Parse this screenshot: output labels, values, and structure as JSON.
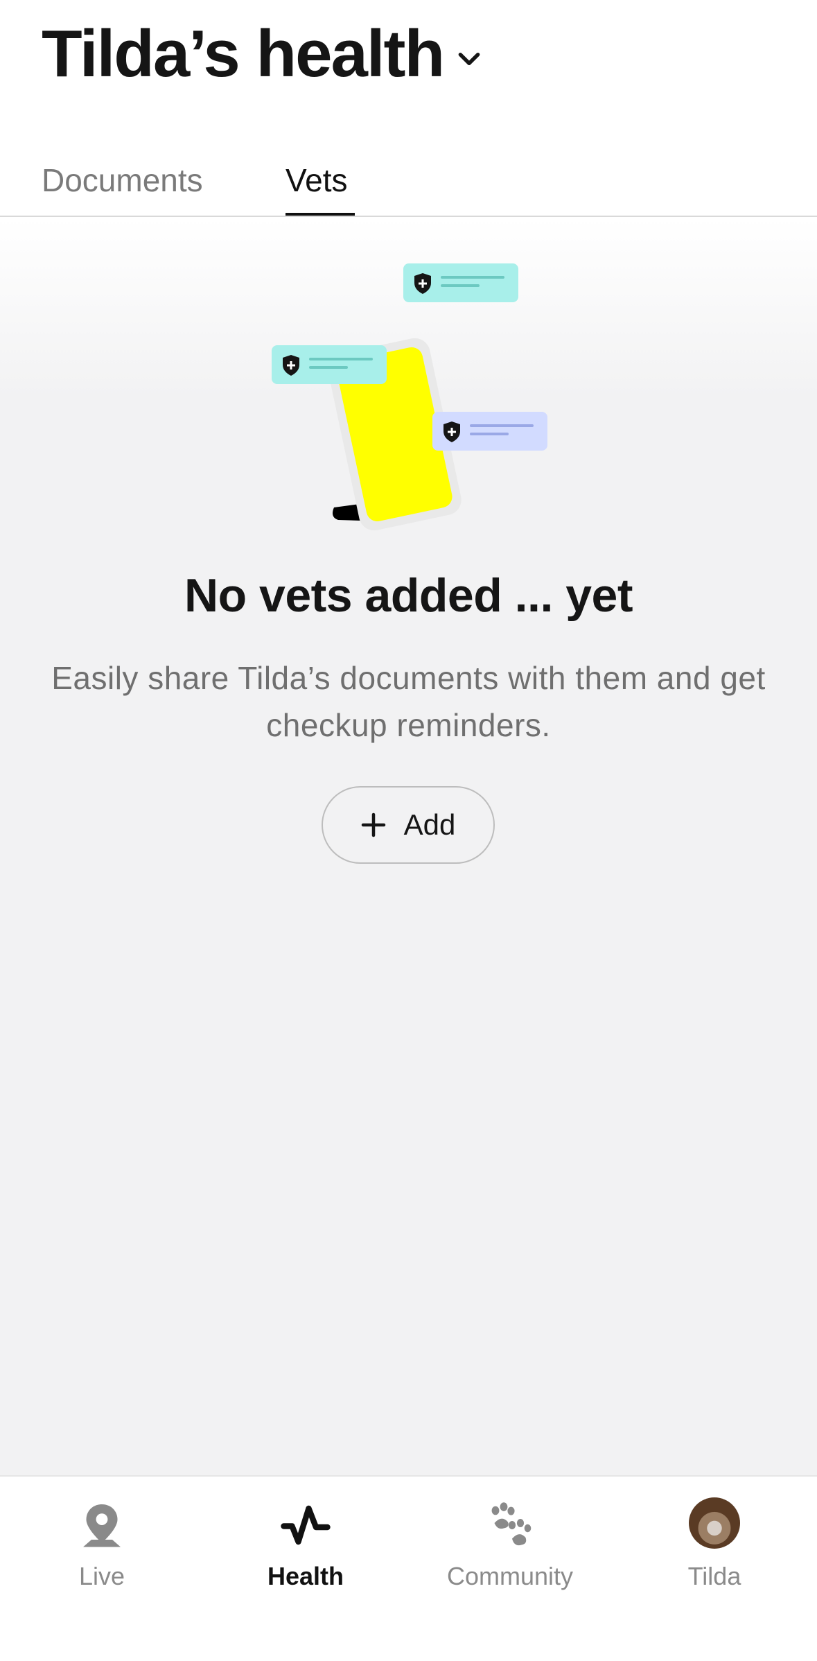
{
  "header": {
    "title": "Tilda’s health",
    "dropdown_icon": "chevron-down-icon"
  },
  "tabs": [
    {
      "label": "Documents",
      "active": false
    },
    {
      "label": "Vets",
      "active": true
    }
  ],
  "empty_state": {
    "title": "No vets added ... yet",
    "description": "Easily share Tilda’s documents with them and get checkup reminders.",
    "add_button_label": "Add",
    "add_icon": "plus-icon"
  },
  "illustration": {
    "phone_color": "#ffff00",
    "card_colors": [
      "#a8efea",
      "#a8efea",
      "#d2dbff"
    ],
    "card_icon": "shield-plus-icon"
  },
  "bottom_nav": [
    {
      "label": "Live",
      "icon": "location-pin-icon",
      "active": false
    },
    {
      "label": "Health",
      "icon": "activity-icon",
      "active": true
    },
    {
      "label": "Community",
      "icon": "paw-icon",
      "active": false
    },
    {
      "label": "Tilda",
      "icon": "pet-avatar",
      "active": false
    }
  ],
  "colors": {
    "text_primary": "#151515",
    "text_secondary": "#7a7a7a",
    "background": "#f2f2f3",
    "accent": "#ffff00"
  }
}
